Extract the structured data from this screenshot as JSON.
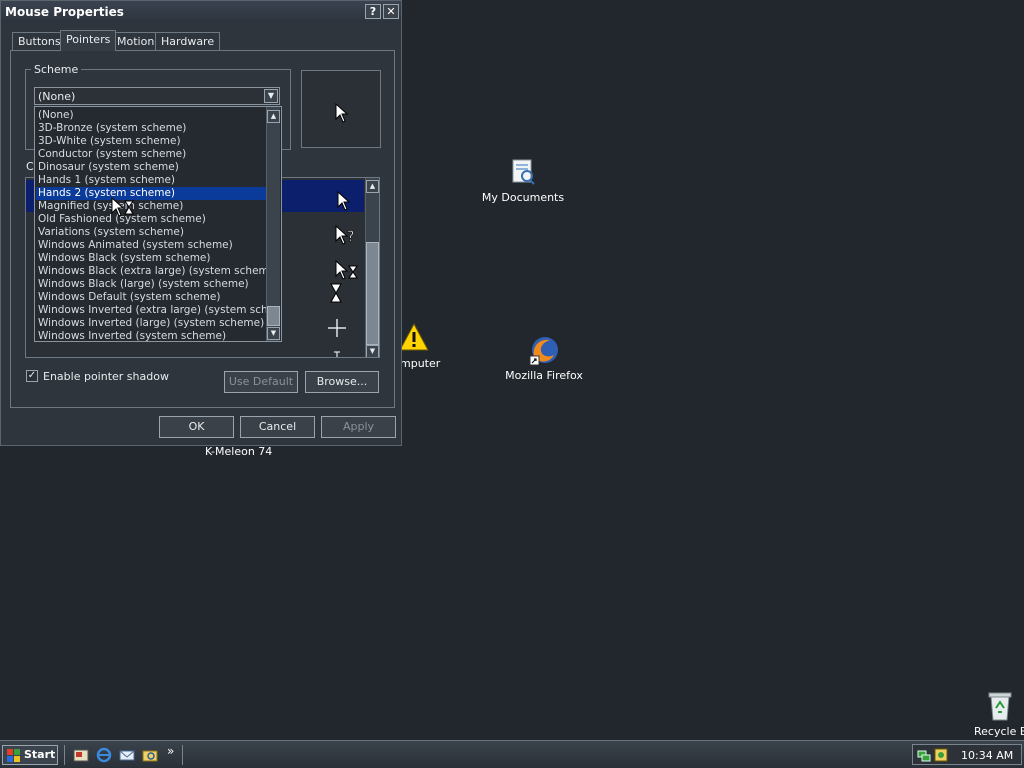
{
  "window": {
    "title": "Mouse Properties",
    "help_label": "?",
    "close_label": "✕"
  },
  "tabs": [
    {
      "label": "Buttons"
    },
    {
      "label": "Pointers"
    },
    {
      "label": "Motion"
    },
    {
      "label": "Hardware"
    }
  ],
  "scheme": {
    "label": "Scheme",
    "selected": "(None)",
    "options": [
      "(None)",
      "3D-Bronze (system scheme)",
      "3D-White (system scheme)",
      "Conductor (system scheme)",
      "Dinosaur (system scheme)",
      "Hands 1 (system scheme)",
      "Hands 2 (system scheme)",
      "Magnified (system scheme)",
      "Old Fashioned (system scheme)",
      "Variations (system scheme)",
      "Windows Animated (system scheme)",
      "Windows Black  (system scheme)",
      "Windows Black (extra large) (system scheme)",
      "Windows Black (large) (system scheme)",
      "Windows Default (system scheme)",
      "Windows Inverted (extra large) (system scheme)",
      "Windows Inverted (large) (system scheme)",
      "Windows Inverted (system scheme)"
    ],
    "highlighted_index": 6
  },
  "customize": {
    "label_fragment": "C"
  },
  "shadow": {
    "label": "Enable pointer shadow",
    "checked": true
  },
  "buttons": {
    "use_default": "Use Default",
    "browse": "Browse...",
    "ok": "OK",
    "cancel": "Cancel",
    "apply": "Apply"
  },
  "desktop": {
    "my_documents": "My Documents",
    "my_computer_partial": "mputer",
    "firefox": "Mozilla Firefox",
    "kmeleon": "K-Meleon 74",
    "recycle": "Recycle Bin"
  },
  "taskbar": {
    "start": "Start",
    "more": "»",
    "clock": "10:34 AM"
  },
  "colors": {
    "desktop_bg": "#22272d",
    "selection": "#0b3b9a"
  }
}
